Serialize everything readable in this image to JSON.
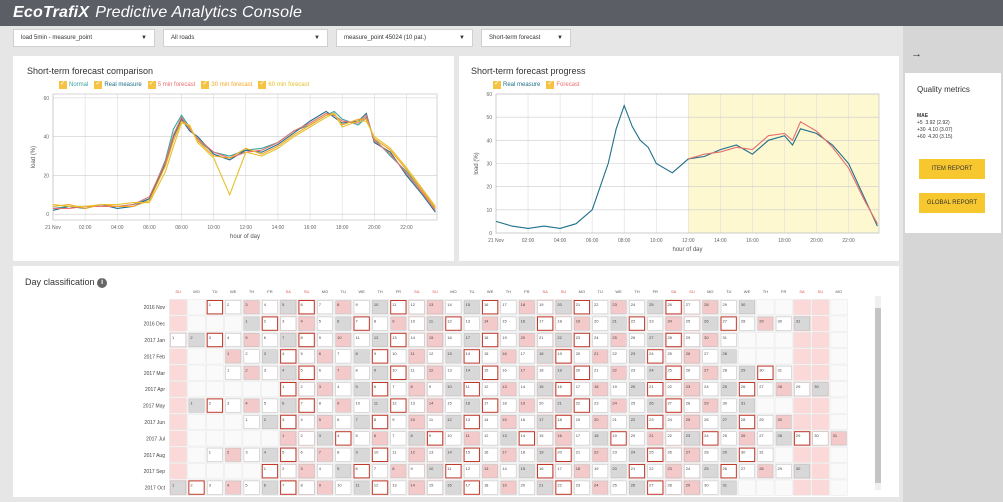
{
  "app": {
    "brand": "EcoTrafiX",
    "title": "Predictive Analytics Console"
  },
  "filters": [
    {
      "value": "load 5min - measure_point"
    },
    {
      "value": "All roads"
    },
    {
      "value": "measure_point 45024 (10 pat.)"
    },
    {
      "value": "Short-term forecast"
    }
  ],
  "comparison": {
    "title": "Short-term forecast comparison",
    "legend": [
      {
        "name": "Normal",
        "color": "#3aa6a0"
      },
      {
        "name": "Real measure",
        "color": "#1f6f8b"
      },
      {
        "name": "5 min forecast",
        "color": "#e8706e"
      },
      {
        "name": "30 min forecast",
        "color": "#f5a623"
      },
      {
        "name": "60 min forecast",
        "color": "#e6c02a"
      }
    ]
  },
  "progress": {
    "title": "Short-term forecast progress",
    "legend": [
      {
        "name": "Real measure",
        "color": "#1f6f8b"
      },
      {
        "name": "Forecast",
        "color": "#e8706e"
      }
    ]
  },
  "chart_data": [
    {
      "type": "line",
      "title": "Short-term forecast comparison",
      "xlabel": "hour of day",
      "ylabel": "load (%)",
      "xticks": [
        "21 Nov",
        "02:00",
        "04:00",
        "06:00",
        "08:00",
        "10:00",
        "12:00",
        "14:00",
        "16:00",
        "18:00",
        "20:00",
        "22:00"
      ],
      "yticks": [
        0,
        20,
        40,
        60
      ],
      "ylim": [
        -3,
        62
      ],
      "xlim": [
        0,
        23.9
      ],
      "grid": true,
      "legend_position": "top",
      "x": [
        0,
        1,
        2,
        3,
        4,
        5,
        6,
        7,
        7.5,
        8,
        8.5,
        9,
        10,
        11,
        12,
        13,
        14,
        15,
        16,
        17,
        17.5,
        18,
        19,
        19.5,
        20,
        21,
        22,
        23,
        23.8
      ],
      "series": [
        {
          "name": "Normal",
          "color": "#3aa6a0",
          "values": [
            3,
            4,
            4,
            4,
            4,
            5,
            8,
            28,
            44,
            51,
            45,
            38,
            32,
            30,
            33,
            34,
            37,
            43,
            46,
            51,
            53,
            49,
            46,
            50,
            39,
            30,
            22,
            12,
            3
          ]
        },
        {
          "name": "Real measure",
          "color": "#1f6f8b",
          "values": [
            2,
            4,
            3,
            5,
            3,
            4,
            8,
            26,
            40,
            49,
            43,
            40,
            31,
            28,
            33,
            32,
            36,
            42,
            48,
            53,
            50,
            47,
            48,
            52,
            37,
            32,
            20,
            10,
            1
          ]
        },
        {
          "name": "5 min forecast",
          "color": "#e8706e",
          "values": [
            3,
            3,
            4,
            4,
            4,
            5,
            9,
            27,
            41,
            50,
            44,
            39,
            32,
            29,
            32,
            33,
            37,
            43,
            47,
            52,
            51,
            48,
            47,
            51,
            38,
            31,
            21,
            11,
            2
          ]
        },
        {
          "name": "30 min forecast",
          "color": "#f5a623",
          "values": [
            4,
            5,
            3,
            5,
            4,
            4,
            7,
            25,
            38,
            48,
            45,
            38,
            30,
            29,
            34,
            31,
            35,
            41,
            46,
            51,
            52,
            46,
            49,
            49,
            39,
            33,
            23,
            12,
            3
          ]
        },
        {
          "name": "60 min forecast",
          "color": "#e6c02a",
          "values": [
            5,
            4,
            4,
            5,
            5,
            6,
            6,
            22,
            35,
            47,
            46,
            37,
            29,
            10,
            32,
            30,
            34,
            40,
            45,
            50,
            52,
            45,
            48,
            48,
            40,
            34,
            24,
            13,
            4
          ]
        }
      ]
    },
    {
      "type": "line",
      "title": "Short-term forecast progress",
      "xlabel": "hour of day",
      "ylabel": "load (%)",
      "xticks": [
        "21 Nov",
        "02:00",
        "04:00",
        "06:00",
        "08:00",
        "10:00",
        "12:00",
        "14:00",
        "16:00",
        "18:00",
        "20:00",
        "22:00"
      ],
      "yticks": [
        0,
        10,
        20,
        30,
        40,
        50,
        60
      ],
      "ylim": [
        0,
        60
      ],
      "xlim": [
        0,
        23.9
      ],
      "grid": true,
      "legend_position": "top",
      "highlight_from_hour": 12,
      "x": [
        0,
        1,
        2,
        3,
        4,
        5,
        6,
        6.5,
        7,
        7.5,
        8,
        8.5,
        9,
        9.5,
        10,
        11,
        12,
        13,
        14,
        15,
        16,
        17,
        18,
        18.5,
        19,
        20,
        21,
        22,
        23,
        23.8
      ],
      "series": [
        {
          "name": "Real measure",
          "color": "#1f6f8b",
          "values": [
            5,
            3,
            2,
            3,
            2,
            4,
            10,
            20,
            30,
            45,
            55,
            46,
            40,
            37,
            30,
            26,
            32,
            33,
            36,
            38,
            34,
            40,
            42,
            38,
            45,
            43,
            38,
            30,
            15,
            3
          ]
        },
        {
          "name": "Forecast",
          "color": "#e8706e",
          "values": [
            null,
            null,
            null,
            null,
            null,
            null,
            null,
            null,
            null,
            null,
            null,
            null,
            null,
            null,
            null,
            null,
            32,
            34,
            35,
            37,
            36,
            42,
            43,
            40,
            48,
            44,
            37,
            28,
            14,
            4
          ]
        }
      ]
    }
  ],
  "day_classification": {
    "title": "Day classification",
    "weekdays": [
      "SU",
      "MO",
      "TU",
      "WE",
      "TH",
      "FR",
      "SA",
      "SU",
      "MO",
      "TU",
      "WE",
      "TH",
      "FR",
      "SA",
      "SU",
      "MO",
      "TU",
      "WE",
      "TH",
      "FR",
      "SA",
      "SU",
      "MO",
      "TU",
      "WE",
      "TH",
      "FR",
      "SA",
      "SU",
      "MO",
      "TU",
      "WE",
      "TH",
      "FR",
      "SA",
      "SU",
      "MO"
    ],
    "months": [
      {
        "label": "2016 Nov",
        "start": 2,
        "days": 30
      },
      {
        "label": "2016 Dec",
        "start": 4,
        "days": 31
      },
      {
        "label": "2017 Jan",
        "start": 0,
        "days": 31
      },
      {
        "label": "2017 Feb",
        "start": 3,
        "days": 28
      },
      {
        "label": "2017 Mar",
        "start": 3,
        "days": 31
      },
      {
        "label": "2017 Apr",
        "start": 6,
        "days": 30
      },
      {
        "label": "2017 May",
        "start": 1,
        "days": 31
      },
      {
        "label": "2017 Jun",
        "start": 4,
        "days": 30
      },
      {
        "label": "2017 Jul",
        "start": 6,
        "days": 31
      },
      {
        "label": "2017 Aug",
        "start": 2,
        "days": 31
      },
      {
        "label": "2017 Sep",
        "start": 5,
        "days": 30
      },
      {
        "label": "2017 Oct",
        "start": 0,
        "days": 31
      }
    ]
  },
  "quality": {
    "title": "Quality metrics",
    "metric_name": "MAE",
    "rows": [
      {
        "horizon": "+5",
        "value": "3.92 (2.92)"
      },
      {
        "horizon": "+30",
        "value": "4.10 (3.07)"
      },
      {
        "horizon": "+60",
        "value": "4.20 (3.15)"
      }
    ],
    "item_report": "ITEM REPORT",
    "global_report": "GLOBAL REPORT"
  },
  "icons": {
    "collapse": "arrow-right-icon",
    "info": "info-icon"
  },
  "colors": {
    "accent": "#f7c72f",
    "topbar": "#5b5e64",
    "highlight": "#fdf8d0",
    "weekend": "#fbd9d9"
  }
}
